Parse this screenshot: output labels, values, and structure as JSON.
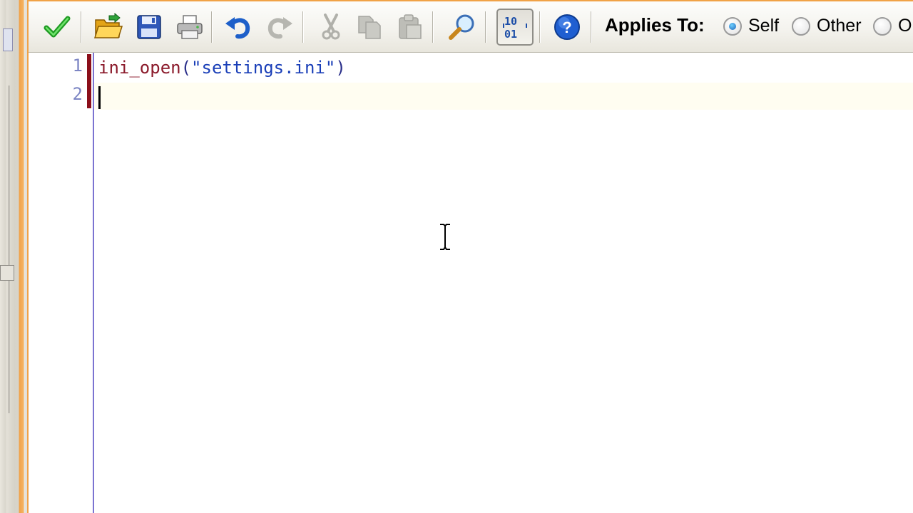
{
  "toolbar": {
    "buttons": [
      {
        "name": "accept",
        "icon": "checkmark-icon",
        "enabled": true
      },
      {
        "name": "open",
        "icon": "folder-open-icon",
        "enabled": true
      },
      {
        "name": "save",
        "icon": "floppy-disk-icon",
        "enabled": true
      },
      {
        "name": "print",
        "icon": "printer-icon",
        "enabled": true
      },
      {
        "name": "undo",
        "icon": "undo-icon",
        "enabled": true
      },
      {
        "name": "redo",
        "icon": "redo-icon",
        "enabled": false
      },
      {
        "name": "cut",
        "icon": "scissors-icon",
        "enabled": false
      },
      {
        "name": "copy",
        "icon": "copy-icon",
        "enabled": false
      },
      {
        "name": "paste",
        "icon": "paste-icon",
        "enabled": false
      },
      {
        "name": "find",
        "icon": "magnifier-icon",
        "enabled": true
      },
      {
        "name": "code-toggle",
        "icon": "binary-code-icon",
        "enabled": true,
        "pressed": true
      },
      {
        "name": "help",
        "icon": "help-icon",
        "enabled": true
      }
    ],
    "applies_to": {
      "label": "Applies To:",
      "options": [
        {
          "label": "Self",
          "checked": true
        },
        {
          "label": "Other",
          "checked": false
        },
        {
          "label": "O",
          "checked": false
        }
      ]
    }
  },
  "editor": {
    "lines": [
      {
        "number": "1",
        "tokens": [
          {
            "type": "fn",
            "text": "ini_open"
          },
          {
            "type": "punct",
            "text": "("
          },
          {
            "type": "str",
            "text": "\"settings.ini\""
          },
          {
            "type": "punct",
            "text": ")"
          }
        ]
      },
      {
        "number": "2",
        "tokens": []
      }
    ],
    "current_line": 2
  },
  "colors": {
    "window_border": "#f0a247",
    "gutter_rule": "#7b73d1",
    "function": "#8b1a2b",
    "string": "#1a3fb8",
    "line_number": "#7d86c4",
    "change_marker": "#8b0f1a"
  }
}
